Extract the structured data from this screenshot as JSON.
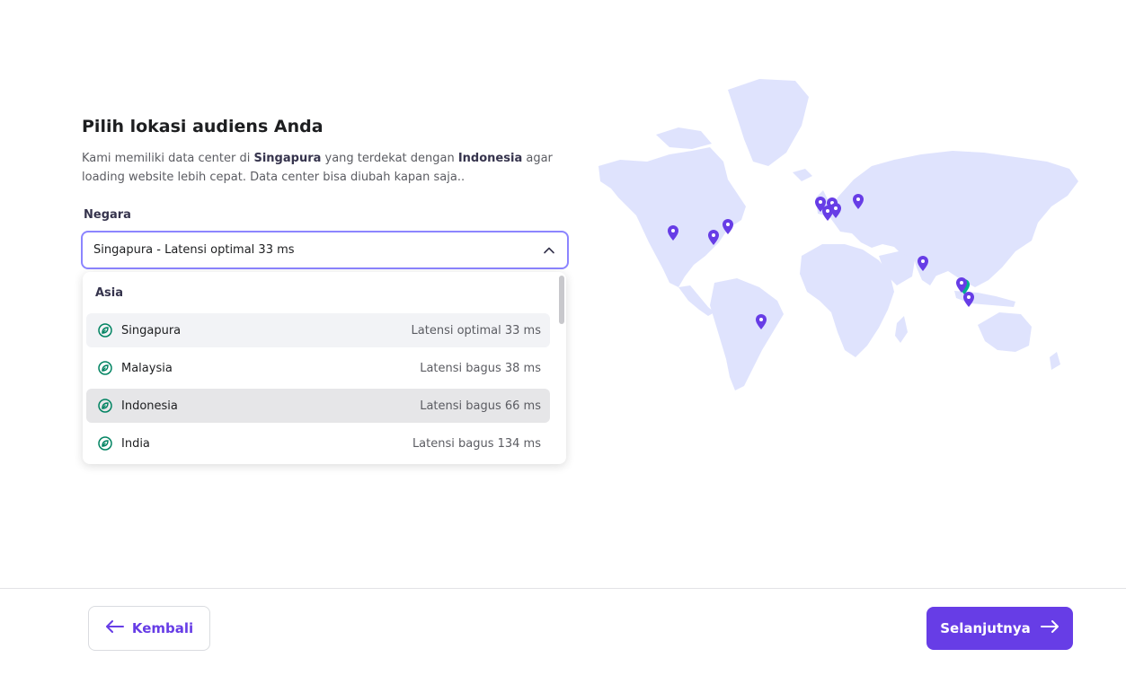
{
  "heading": "Pilih lokasi audiens Anda",
  "description": {
    "part1": "Kami memiliki data center di ",
    "bold1": "Singapura",
    "part2": " yang terdekat dengan ",
    "bold2": "Indonesia",
    "part3": " agar loading website lebih cepat. Data center bisa diubah kapan saja.."
  },
  "country_field": {
    "label": "Negara",
    "selected": "Singapura - Latensi optimal 33 ms"
  },
  "dropdown": {
    "group": "Asia",
    "items": [
      {
        "name": "Singapura",
        "latency": "Latensi optimal 33 ms"
      },
      {
        "name": "Malaysia",
        "latency": "Latensi bagus 38 ms"
      },
      {
        "name": "Indonesia",
        "latency": "Latensi bagus 66 ms"
      },
      {
        "name": "India",
        "latency": "Latensi bagus 134 ms"
      }
    ]
  },
  "buttons": {
    "back": "Kembali",
    "next": "Selanjutnya"
  },
  "icons": {
    "leaf": "leaf-icon",
    "chevron": "chevron-up-icon",
    "back": "arrow-left-icon",
    "next": "arrow-right-icon",
    "map_pin": "map-pin-icon"
  },
  "colors": {
    "accent": "#673de6",
    "focus_border": "#8c85ff",
    "map_land": "#dfe3fd",
    "pin": "#673de6",
    "pin_selected": "#00b090",
    "leaf": "#008361"
  }
}
